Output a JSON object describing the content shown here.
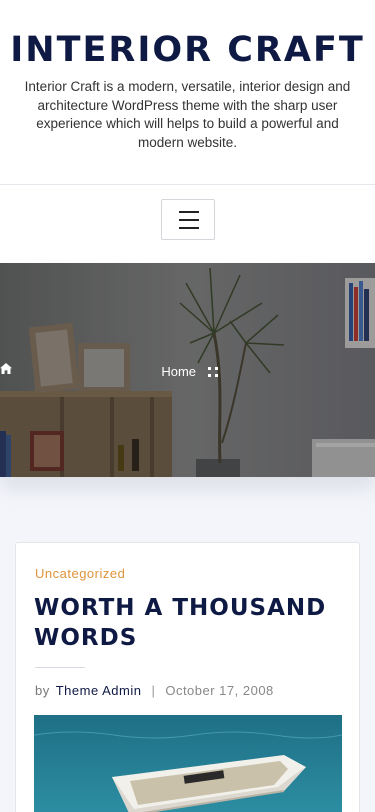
{
  "header": {
    "site_title": "INTERIOR CRAFT",
    "site_description": "Interior Craft is a modern, versatile, interior design and architecture WordPress theme with the sharp user experience which will helps to build a powerful and modern website."
  },
  "nav": {
    "menu_icon": "hamburger-menu-icon"
  },
  "hero": {
    "breadcrumb_home": "Home",
    "home_icon": "home-icon",
    "separator_icon": "grid-separator-icon"
  },
  "post": {
    "category": "Uncategorized",
    "title": "WORTH A THOUSAND WORDS",
    "by_label": "by",
    "author": "Theme Admin",
    "separator": "|",
    "date": "October 17, 2008"
  },
  "colors": {
    "title_navy": "#0f1a44",
    "category_orange": "#e0943c",
    "page_bg": "#f3f5fa"
  }
}
